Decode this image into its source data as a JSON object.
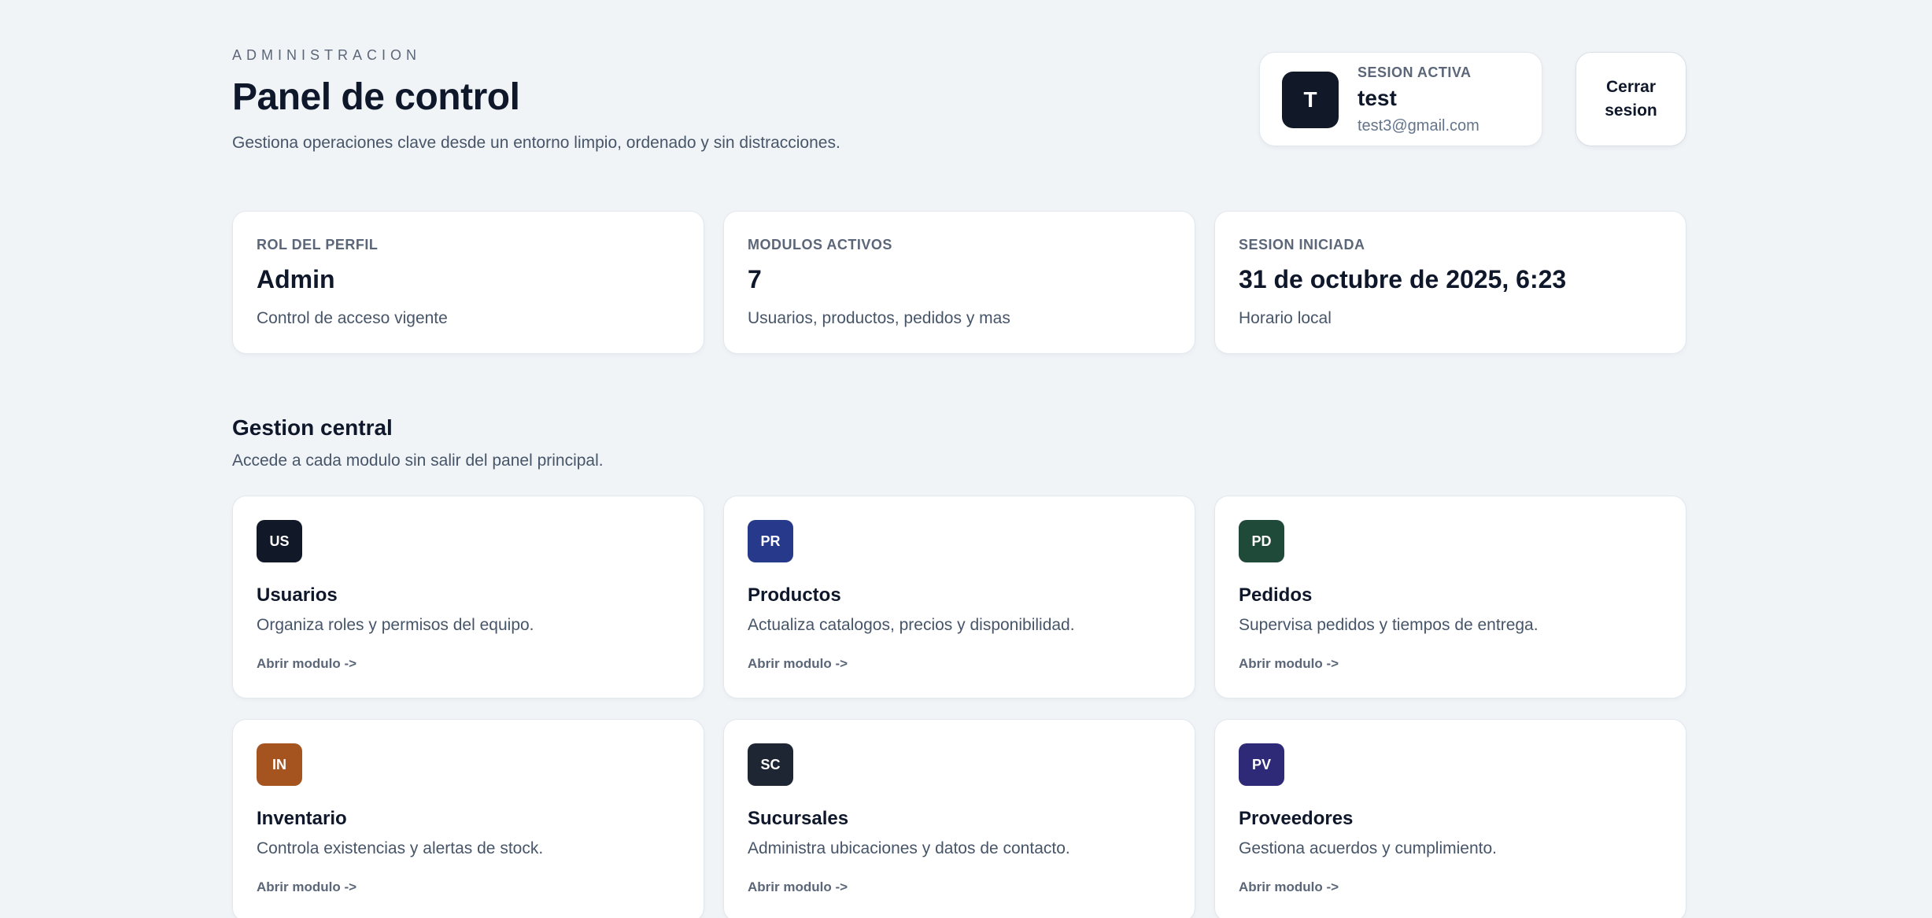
{
  "header": {
    "eyebrow": "ADMINISTRACION",
    "title": "Panel de control",
    "subtitle": "Gestiona operaciones clave desde un entorno limpio, ordenado y sin distracciones."
  },
  "session": {
    "avatar_initial": "T",
    "label": "SESION ACTIVA",
    "username": "test",
    "email": "test3@gmail.com",
    "logout_label": "Cerrar sesion"
  },
  "stats": [
    {
      "label": "ROL DEL PERFIL",
      "value": "Admin",
      "note": "Control de acceso vigente"
    },
    {
      "label": "MODULOS ACTIVOS",
      "value": "7",
      "note": "Usuarios, productos, pedidos y mas"
    },
    {
      "label": "SESION INICIADA",
      "value": "31 de octubre de 2025, 6:23",
      "note": "Horario local"
    }
  ],
  "section": {
    "title": "Gestion central",
    "subtitle": "Accede a cada modulo sin salir del panel principal."
  },
  "modules": [
    {
      "badge": "US",
      "badge_color": "#111827",
      "name": "Usuarios",
      "description": "Organiza roles y permisos del equipo.",
      "link": "Abrir modulo ->"
    },
    {
      "badge": "PR",
      "badge_color": "#27398a",
      "name": "Productos",
      "description": "Actualiza catalogos, precios y disponibilidad.",
      "link": "Abrir modulo ->"
    },
    {
      "badge": "PD",
      "badge_color": "#1f4a3a",
      "name": "Pedidos",
      "description": "Supervisa pedidos y tiempos de entrega.",
      "link": "Abrir modulo ->"
    },
    {
      "badge": "IN",
      "badge_color": "#a6541f",
      "name": "Inventario",
      "description": "Controla existencias y alertas de stock.",
      "link": "Abrir modulo ->"
    },
    {
      "badge": "SC",
      "badge_color": "#1e2533",
      "name": "Sucursales",
      "description": "Administra ubicaciones y datos de contacto.",
      "link": "Abrir modulo ->"
    },
    {
      "badge": "PV",
      "badge_color": "#2f2a78",
      "name": "Proveedores",
      "description": "Gestiona acuerdos y cumplimiento.",
      "link": "Abrir modulo ->"
    }
  ]
}
